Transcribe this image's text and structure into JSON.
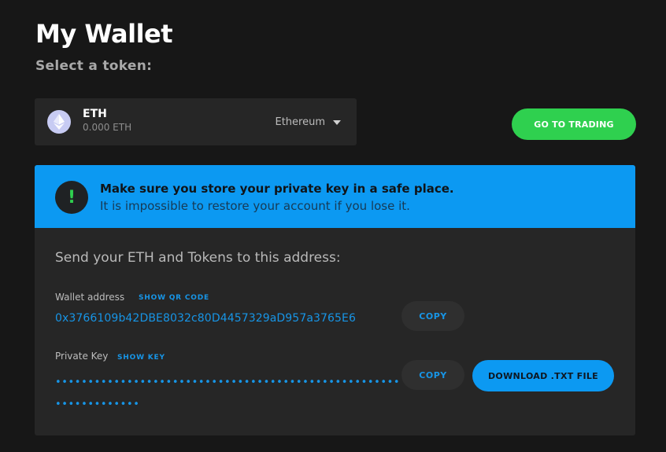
{
  "header": {
    "title": "My Wallet",
    "subtitle": "Select a token:"
  },
  "token_select": {
    "symbol": "ETH",
    "balance": "0.000 ETH",
    "network": "Ethereum",
    "icon": "ethereum-icon"
  },
  "actions": {
    "go_to_trading": "GO TO TRADING"
  },
  "alert": {
    "title": "Make sure you store your private key in a safe place.",
    "text": "It is impossible to restore your account if you lose it.",
    "icon_glyph": "!"
  },
  "wallet": {
    "heading": "Send your ETH and Tokens to this address:",
    "address_label": "Wallet address",
    "show_qr_label": "SHOW QR CODE",
    "address": "0x3766109b42DBE8032c80D4457329aD957a3765E6",
    "copy_address_label": "COPY",
    "private_key_label": "Private Key",
    "show_key_label": "SHOW KEY",
    "private_key_masked": "••••••••••••••••••••••••••••••••••••••••••••••••••••••••••••••••••",
    "copy_key_label": "COPY",
    "download_label": "DOWNLOAD .TXT FILE"
  },
  "colors": {
    "background": "#171717",
    "panel": "#262626",
    "accent_blue": "#0c99f2",
    "link_blue": "#1795e6",
    "accent_green": "#2fd04f"
  }
}
